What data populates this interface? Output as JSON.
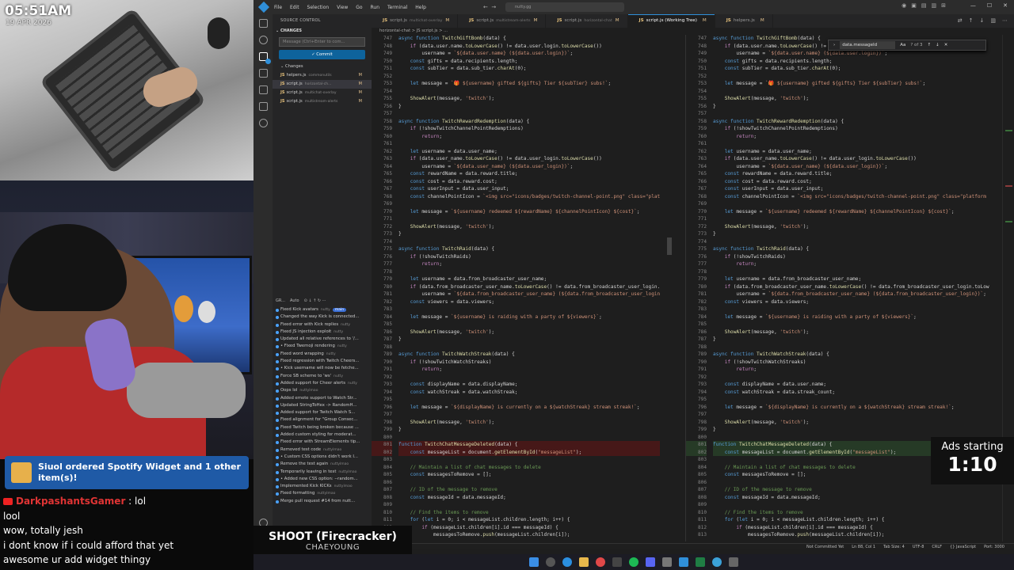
{
  "overlay": {
    "clock": "05:51AM",
    "date": "19 APR 2026",
    "alert": "Siuol ordered Spotify Widget and 1 other item(s)!",
    "song_title": "SHOOT (Firecracker)",
    "song_artist": "CHAEYOUNG",
    "ads_label": "Ads starting",
    "ads_time": "1:10"
  },
  "chat": [
    {
      "user": "DarkpashantsGamer",
      "text": " : lol"
    },
    {
      "user": "",
      "text": "lool"
    },
    {
      "user": "",
      "text": "wow, totally jesh"
    },
    {
      "user": "",
      "text": "i dont know if i could afford that yet"
    },
    {
      "user": "",
      "text": "awesome ur add widget thingy"
    }
  ],
  "titlebar": {
    "menu": [
      "File",
      "Edit",
      "Selection",
      "View",
      "Go",
      "Run",
      "Terminal",
      "Help"
    ],
    "command": "nutty.gg"
  },
  "sidebar": {
    "title": "SOURCE CONTROL",
    "changes_header": "CHANGES",
    "message_placeholder": "Message (Ctrl+Enter to com...",
    "commit_label": "✓ Commit",
    "changes_group": "Changes",
    "files": [
      {
        "name": "helpers.js",
        "dir": "commonutils",
        "status": "M"
      },
      {
        "name": "script.js",
        "dir": "horizontal-ch...",
        "status": "M"
      },
      {
        "name": "script.js",
        "dir": "multichat-overlay",
        "status": "M"
      },
      {
        "name": "script.js",
        "dir": "multistream-alerts",
        "status": "M"
      }
    ],
    "graph_title": "GR...",
    "graph_auto": "Auto",
    "graph": [
      {
        "msg": "Fixed Kick avatars",
        "author": "nutty",
        "tag": "main"
      },
      {
        "msg": "Changed the way Kick is connected...",
        "author": ""
      },
      {
        "msg": "Fixed error with Kick replies",
        "author": "nutty"
      },
      {
        "msg": "Fixed JS injection exploit",
        "author": "nutty"
      },
      {
        "msg": "Updated all relative references to '/...",
        "author": ""
      },
      {
        "msg": "• Fixed Twemoji rendering",
        "author": "nutty"
      },
      {
        "msg": "Fixed word wrapping",
        "author": "nutty"
      },
      {
        "msg": "Fixed regression with Twitch Cheers...",
        "author": ""
      },
      {
        "msg": "• Kick username will now be fetche...",
        "author": ""
      },
      {
        "msg": "Force SB scheme to 'ws'",
        "author": "nutty"
      },
      {
        "msg": "Added support for Cheer alerts",
        "author": "nutty"
      },
      {
        "msg": "Oops lol",
        "author": "nuttylmao"
      },
      {
        "msg": "Added emote support to Watch Str...",
        "author": ""
      },
      {
        "msg": "Updated StringToHex -> RandomH...",
        "author": ""
      },
      {
        "msg": "Added support for Twitch Watch S...",
        "author": ""
      },
      {
        "msg": "Fixed alignment for \"Group Consec...",
        "author": ""
      },
      {
        "msg": "Fixed Twitch being broken because ...",
        "author": ""
      },
      {
        "msg": "Added custom styling for moderat...",
        "author": ""
      },
      {
        "msg": "Fixed error with StreamElements tip...",
        "author": ""
      },
      {
        "msg": "Removed test code",
        "author": "nuttylmao"
      },
      {
        "msg": "• Custom CSS options didn't work I...",
        "author": ""
      },
      {
        "msg": "Remove the test again",
        "author": "nuttylmao"
      },
      {
        "msg": "Temporarily leaving in test",
        "author": "nuttylmao"
      },
      {
        "msg": "• Added new CSS option: --random...",
        "author": ""
      },
      {
        "msg": "Implemented Kick KICKs",
        "author": "nuttylmao"
      },
      {
        "msg": "Fixed formatting",
        "author": "nuttylmao"
      },
      {
        "msg": "Merge pull request #14 from nutt...",
        "author": ""
      }
    ]
  },
  "tabs": [
    {
      "name": "script.js",
      "dir": "multichat-overlay",
      "mod": "M",
      "active": false
    },
    {
      "name": "script.js",
      "dir": "multistream-alerts",
      "mod": "M",
      "active": false
    },
    {
      "name": "script.js",
      "dir": "horizontal-chat",
      "mod": "M",
      "active": false
    },
    {
      "name": "script.js (Working Tree)",
      "dir": "",
      "mod": "M",
      "active": true
    },
    {
      "name": "helpers.js",
      "dir": "",
      "mod": "M",
      "active": false
    }
  ],
  "breadcrumb": "horizontal-chat  >  JS script.js  >  ...",
  "find": {
    "value": "data.messageId",
    "count": "? of 3"
  },
  "statusbar": [
    "Not Committed Yet",
    "Ln 88, Col 1",
    "Tab Size: 4",
    "UTF-8",
    "CRLF",
    "{} JavaScript",
    "Port: 3000"
  ],
  "code_left": [
    "async function TwitchGiftBomb(data) {",
    "    if (data.user.name.toLowerCase() != data.user.login.toLowerCase())",
    "        username = `${data.user.name} (${data.user.login})`;",
    "    const gifts = data.recipients.length;",
    "    const subTier = data.sub_tier.charAt(0);",
    "",
    "    let message = `🎁 ${username} gifted ${gifts} Tier ${subTier} subs!`;",
    "",
    "    ShowAlert(message, 'twitch');",
    "}",
    "",
    "async function TwitchRewardRedemption(data) {",
    "    if (!showTwitchChannelPointRedemptions)",
    "        return;",
    "",
    "    let username = data.user_name;",
    "    if (data.user_name.toLowerCase() != data.user_login.toLowerCase())",
    "        username = `${data.user_name} (${data.user_login})`;",
    "    const rewardName = data.reward.title;",
    "    const cost = data.reward.cost;",
    "    const userInput = data.user_input;",
    "    const channelPointIcon = `<img src=\"icons/badges/twitch-channel-point.png\" class=\"plat",
    "",
    "    let message = `${username} redeemed ${rewardName} ${channelPointIcon} ${cost}`;",
    "",
    "    ShowAlert(message, 'twitch');",
    "}",
    "",
    "async function TwitchRaid(data) {",
    "    if (!showTwitchRaids)",
    "        return;",
    "",
    "    let username = data.from_broadcaster_user_name;",
    "    if (data.from_broadcaster_user_name.toLowerCase() != data.from_broadcaster_user_login.",
    "        username = `${data.from_broadcaster_user_name} (${data.from_broadcaster_user_login",
    "    const viewers = data.viewers;",
    "",
    "    let message = `${username} is raiding with a party of ${viewers}`;",
    "",
    "    ShowAlert(message, 'twitch');",
    "}",
    "",
    "async function TwitchWatchStreak(data) {",
    "    if (!showTwitchWatchStreaks)",
    "        return;",
    "",
    "    const displayName = data.displayName;",
    "    const watchStreak = data.watchStreak;",
    "",
    "    let message = `${displayName} is currently on a ${watchStreak} stream streak!`;",
    "",
    "    ShowAlert(message, 'twitch');",
    "}",
    "",
    "function TwitchChatMessageDeleted(data) {",
    "    const messageList = document.getElementById(\"messageList\");",
    "",
    "    // Maintain a list of chat messages to delete",
    "    const messagesToRemove = [];",
    "",
    "    // ID of the message to remove",
    "    const messageId = data.messageId;",
    "",
    "    // Find the items to remove",
    "    for (let i = 0; i < messageList.children.length; i++) {",
    "        if (messageList.children[i].id === messageId) {",
    "            messagesToRemove.push(messageList.children[i]);"
  ],
  "code_right": [
    "async function TwitchGiftBomb(data) {",
    "    if (data.user.name.toLowerCase() != data.user.login.toLowerCase())",
    "        username = `${data.user.name} (${data.user.login})`;",
    "    const gifts = data.recipients.length;",
    "    const subTier = data.sub_tier.charAt(0);",
    "",
    "    let message = `🎁 ${username} gifted ${gifts} Tier ${subTier} subs!`;",
    "",
    "    ShowAlert(message, 'twitch');",
    "}",
    "",
    "async function TwitchRewardRedemption(data) {",
    "    if (!showTwitchChannelPointRedemptions)",
    "        return;",
    "",
    "    let username = data.user_name;",
    "    if (data.user_name.toLowerCase() != data.user_login.toLowerCase())",
    "        username = `${data.user_name} (${data.user_login})`;",
    "    const rewardName = data.reward.title;",
    "    const cost = data.reward.cost;",
    "    const userInput = data.user_input;",
    "    const channelPointIcon = `<img src=\"icons/badges/twitch-channel-point.png\" class=\"platform",
    "",
    "    let message = `${username} redeemed ${rewardName} ${channelPointIcon} ${cost}`;",
    "",
    "    ShowAlert(message, 'twitch');",
    "}",
    "",
    "async function TwitchRaid(data) {",
    "    if (!showTwitchRaids)",
    "        return;",
    "",
    "    let username = data.from_broadcaster_user_name;",
    "    if (data.from_broadcaster_user_name.toLowerCase() != data.from_broadcaster_user_login.toLow",
    "        username = `${data.from_broadcaster_user_name} (${data.from_broadcaster_user_login})`;",
    "    const viewers = data.viewers;",
    "",
    "    let message = `${username} is raiding with a party of ${viewers}`;",
    "",
    "    ShowAlert(message, 'twitch');",
    "}",
    "",
    "async function TwitchWatchStreak(data) {",
    "    if (!showTwitchWatchStreaks)",
    "        return;",
    "",
    "    const displayName = data.user.name;",
    "    const watchStreak = data.streak_count;",
    "",
    "    let message = `${displayName} is currently on a ${watchStreak} stream streak!`;",
    "",
    "    ShowAlert(message, 'twitch');",
    "}",
    "",
    "function TwitchChatMessageDeleted(data) {",
    "    const messageList = document.getElementById(\"messageList\");",
    "",
    "    // Maintain a list of chat messages to delete",
    "    const messagesToRemove = [];",
    "",
    "    // ID of the message to remove",
    "    const messageId = data.messageId;",
    "",
    "    // Find the items to remove",
    "    for (let i = 0; i < messageList.children.length; i++) {",
    "        if (messageList.children[i].id === messageId) {",
    "            messagesToRemove.push(messageList.children[i]);"
  ],
  "line_start": 747,
  "deleted_lines": [
    801,
    802
  ],
  "added_lines": [
    801,
    802
  ],
  "colors": {
    "accent": "#007acc",
    "alert_bg": "#1f5aa6",
    "chat_user": "#e03434"
  }
}
